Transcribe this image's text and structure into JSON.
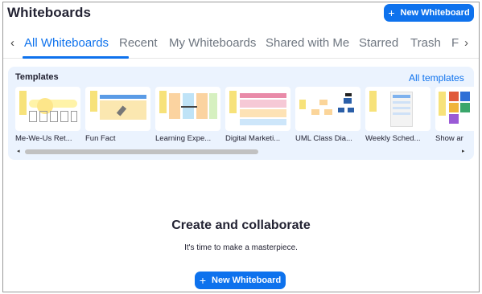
{
  "header": {
    "title": "Whiteboards",
    "new_button_label": "New Whiteboard",
    "plus_icon": "plus-icon"
  },
  "tabs": {
    "items": [
      "All Whiteboards",
      "Recent",
      "My Whiteboards",
      "Shared with Me",
      "Starred",
      "Trash",
      "F"
    ],
    "active": "All Whiteboards",
    "left_arrow": "‹",
    "right_arrow": "›"
  },
  "templates": {
    "heading": "Templates",
    "all_link": "All templates",
    "items": [
      {
        "label": "Me-We-Us Ret..."
      },
      {
        "label": "Fun Fact"
      },
      {
        "label": "Learning Expe..."
      },
      {
        "label": "Digital Marketi..."
      },
      {
        "label": "UML Class Dia..."
      },
      {
        "label": "Weekly Sched..."
      },
      {
        "label": "Show ar"
      }
    ],
    "scroll_left": "◂",
    "scroll_right": "▸"
  },
  "empty_state": {
    "title": "Create and collaborate",
    "subtitle": "It's time to make a masterpiece.",
    "button_label": "New Whiteboard"
  },
  "colors": {
    "accent": "#0e72ed",
    "panel_bg": "#ebf3fe"
  }
}
